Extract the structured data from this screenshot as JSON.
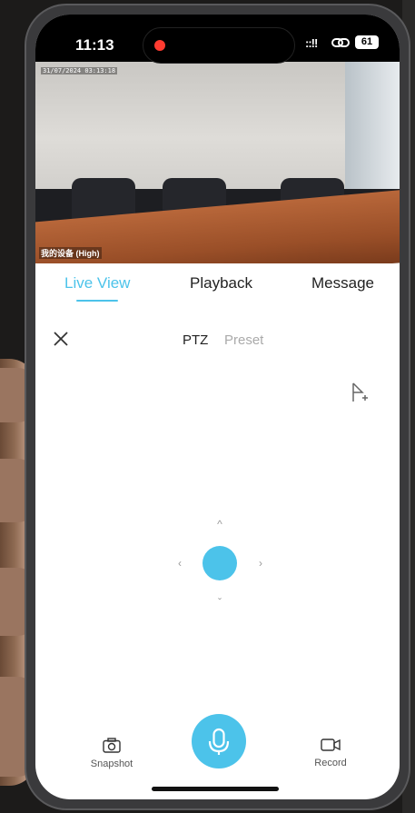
{
  "status_bar": {
    "time": "11:13",
    "signal": "::!!",
    "battery": "61",
    "recording_indicator_color": "#ff3b30"
  },
  "camera": {
    "timestamp": "31/07/2024 03:13:18",
    "device_label": "我的设备 (High)"
  },
  "tabs": [
    {
      "label": "Live View",
      "active": true
    },
    {
      "label": "Playback",
      "active": false
    },
    {
      "label": "Message",
      "active": false
    }
  ],
  "ptz_panel": {
    "close_icon": "close-icon",
    "ptz_label": "PTZ",
    "preset_label": "Preset",
    "add_preset_icon": "flag-plus-icon"
  },
  "joystick": {
    "up_icon": "chevron-up-icon",
    "down_icon": "chevron-down-icon",
    "left_icon": "chevron-left-icon",
    "right_icon": "chevron-right-icon",
    "center_color": "#4cc3ea"
  },
  "controls": {
    "snapshot_label": "Snapshot",
    "record_label": "Record",
    "mic_icon": "microphone-icon"
  },
  "colors": {
    "accent": "#4cc3ea",
    "text": "#222222",
    "muted": "#aaaaaa"
  }
}
